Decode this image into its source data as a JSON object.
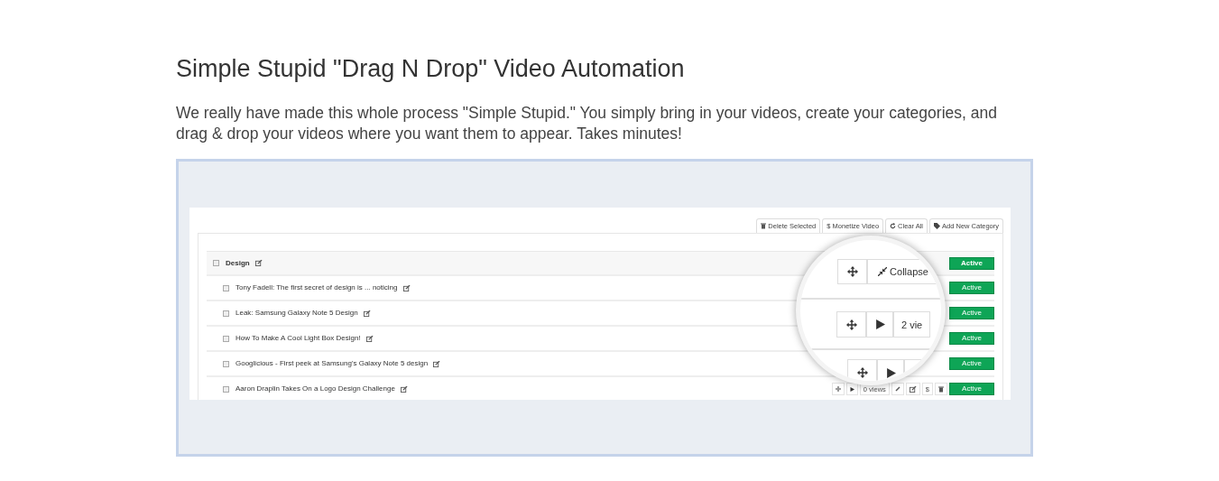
{
  "heading": "Simple Stupid \"Drag N Drop\" Video Automation",
  "intro": "We really have made this whole process \"Simple Stupid.\" You simply bring in your videos, create your categories, and drag & drop your videos where you want them to appear. Takes minutes!",
  "app": {
    "toolbar": [
      {
        "kind": "trash",
        "label": "Delete Selected"
      },
      {
        "kind": "plain",
        "label": "$ Monetize Video"
      },
      {
        "kind": "refresh",
        "label": "Clear All"
      },
      {
        "kind": "tag",
        "label": "Add New Category"
      }
    ],
    "category": {
      "name": "Design",
      "checked": false,
      "status": "Active"
    },
    "videos": [
      {
        "title": "Tony Fadell: The first secret of design is ... noticing",
        "checked": false,
        "status": "Active"
      },
      {
        "title": "Leak: Samsung Galaxy Note 5 Design",
        "checked": false,
        "status": "Active"
      },
      {
        "title": "How To Make A Cool Light Box Design!",
        "checked": false,
        "status": "Active"
      },
      {
        "title": "Googlicious - First peek at Samsung's Galaxy Note 5 design",
        "checked": false,
        "status": "Active"
      },
      {
        "title": "Aaron Draplin Takes On a Logo Design Challenge",
        "checked": false,
        "status": "Active",
        "views": "0 views",
        "money": "$"
      }
    ],
    "magnifier": [
      {
        "kind": "category",
        "label": "Collapse"
      },
      {
        "kind": "video",
        "views": "2 vie"
      },
      {
        "kind": "video"
      }
    ]
  }
}
